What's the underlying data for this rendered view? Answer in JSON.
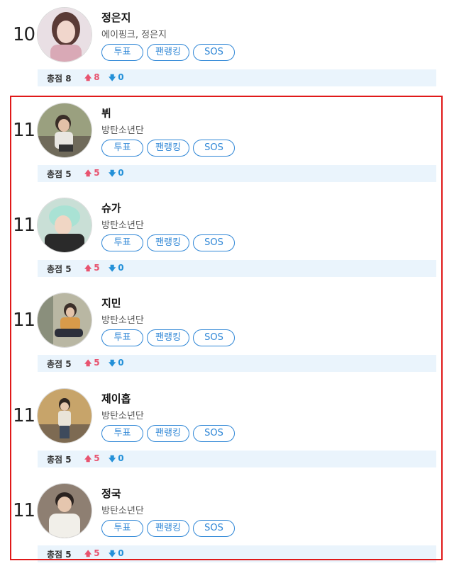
{
  "entries": [
    {
      "rank": "10",
      "name": "정은지",
      "group": "에이핑크, 정은지",
      "vote_label": "투표",
      "fanrank_label": "팬랭킹",
      "sos_label": "SOS",
      "score_label": "총점",
      "score": "8",
      "up": "8",
      "down": "0"
    },
    {
      "rank": "11",
      "name": "뷔",
      "group": "방탄소년단",
      "vote_label": "투표",
      "fanrank_label": "팬랭킹",
      "sos_label": "SOS",
      "score_label": "총점",
      "score": "5",
      "up": "5",
      "down": "0"
    },
    {
      "rank": "11",
      "name": "슈가",
      "group": "방탄소년단",
      "vote_label": "투표",
      "fanrank_label": "팬랭킹",
      "sos_label": "SOS",
      "score_label": "총점",
      "score": "5",
      "up": "5",
      "down": "0"
    },
    {
      "rank": "11",
      "name": "지민",
      "group": "방탄소년단",
      "vote_label": "투표",
      "fanrank_label": "팬랭킹",
      "sos_label": "SOS",
      "score_label": "총점",
      "score": "5",
      "up": "5",
      "down": "0"
    },
    {
      "rank": "11",
      "name": "제이홉",
      "group": "방탄소년단",
      "vote_label": "투표",
      "fanrank_label": "팬랭킹",
      "sos_label": "SOS",
      "score_label": "총점",
      "score": "5",
      "up": "5",
      "down": "0"
    },
    {
      "rank": "11",
      "name": "정국",
      "group": "방탄소년단",
      "vote_label": "투표",
      "fanrank_label": "팬랭킹",
      "sos_label": "SOS",
      "score_label": "총점",
      "score": "5",
      "up": "5",
      "down": "0"
    }
  ],
  "colors": {
    "accent": "#2e86d6",
    "up": "#e8536f",
    "down": "#2390d8",
    "highlight": "#e01919",
    "score_bg": "#eaf4fc"
  }
}
